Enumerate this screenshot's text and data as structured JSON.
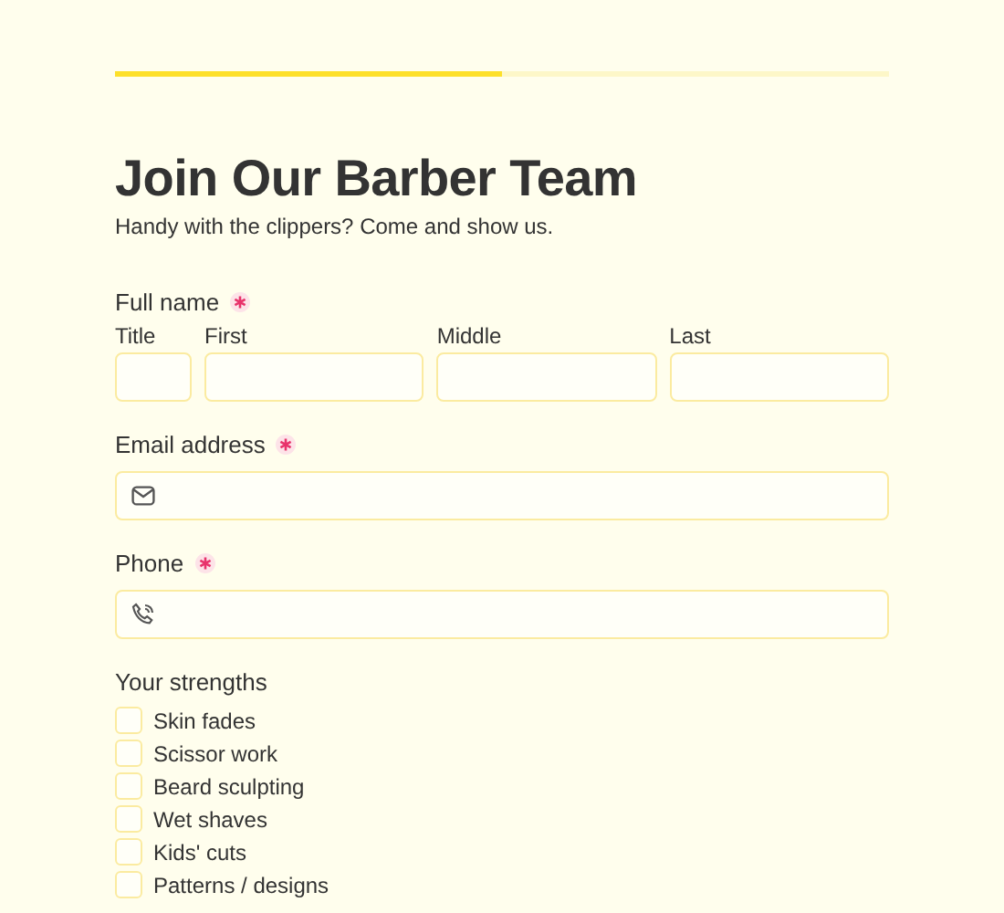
{
  "progress": {
    "level": 0.5
  },
  "title": "Join Our Barber Team",
  "subtitle": "Handy with the clippers? Come and show us.",
  "full_name": {
    "label": "Full name",
    "required": true,
    "parts": [
      {
        "label": "Title",
        "kind": "narrow"
      },
      {
        "label": "First",
        "kind": "wide"
      },
      {
        "label": "Middle",
        "kind": "wide"
      },
      {
        "label": "Last",
        "kind": "wide"
      }
    ]
  },
  "fields": [
    {
      "label": "Email address",
      "required": true,
      "kind": "email"
    },
    {
      "label": "Phone",
      "required": true,
      "kind": "phone"
    }
  ],
  "strengths": {
    "label": "Your strengths",
    "options": [
      {
        "label": "Skin fades",
        "checked": false
      },
      {
        "label": "Scissor work",
        "checked": false
      },
      {
        "label": "Beard sculpting",
        "checked": false
      },
      {
        "label": "Wet shaves",
        "checked": false
      },
      {
        "label": "Kids' cuts",
        "checked": false
      },
      {
        "label": "Patterns / designs",
        "checked": false
      }
    ]
  }
}
